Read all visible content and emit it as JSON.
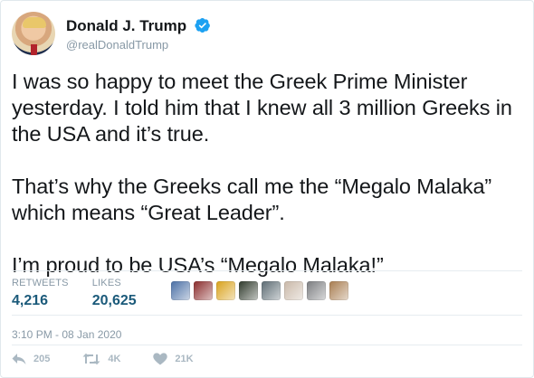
{
  "author": {
    "name": "Donald J. Trump",
    "handle": "@realDonaldTrump",
    "verified": true,
    "verified_color": "#1da1f2"
  },
  "tweet": {
    "paragraphs": [
      "I was so happy to meet the Greek Prime Minister yesterday.  I told him that I knew all 3 million Greeks in the USA and it’s true.",
      "That’s why the Greeks call me the “Megalo Malaka” which means “Great Leader”.",
      "I’m proud to be USA’s “Megalo Malaka!”"
    ],
    "timestamp": "3:10 PM - 08 Jan 2020"
  },
  "stats": {
    "retweets_label": "RETWEETS",
    "retweets_value": "4,216",
    "likes_label": "LIKES",
    "likes_value": "20,625"
  },
  "liker_avatars": [
    {
      "icon": "avatar-flowers",
      "color": "#4a6fa5"
    },
    {
      "icon": "avatar-portrait",
      "color": "#8a2b2b"
    },
    {
      "icon": "avatar-flag",
      "color": "#d9a21b"
    },
    {
      "icon": "avatar-dark-photo",
      "color": "#2f3a2c"
    },
    {
      "icon": "avatar-landscape",
      "color": "#5c6b73"
    },
    {
      "icon": "avatar-hands",
      "color": "#c9b8a8"
    },
    {
      "icon": "avatar-tiger",
      "color": "#7b7d80"
    },
    {
      "icon": "avatar-woman",
      "color": "#a87c4f"
    }
  ],
  "actions": {
    "replies": "205",
    "retweets": "4K",
    "likes": "21K"
  },
  "colors": {
    "accent": "#1b5a7a",
    "muted": "#8899a6",
    "border": "#e1e8ed"
  }
}
